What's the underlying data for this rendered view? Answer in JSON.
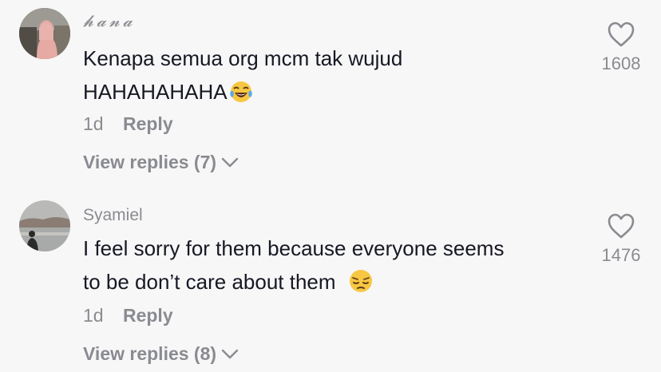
{
  "comments": [
    {
      "username": "𝓱𝓪𝓷𝓪",
      "text_line1": "Kenapa semua org mcm tak wujud",
      "text_line2": "HAHAHAHAHA",
      "emoji": "tears-of-joy-emoji",
      "age": "1d",
      "reply_label": "Reply",
      "view_replies": "View replies (7)",
      "likes": "1608"
    },
    {
      "username": "Syamiel",
      "text_line1": "I feel sorry for them because everyone seems",
      "text_line2": "to be don’t care about them",
      "emoji": "pensive-face-emoji",
      "age": "1d",
      "reply_label": "Reply",
      "view_replies": "View replies (8)",
      "likes": "1476"
    }
  ],
  "icons": {
    "like": "heart-outline-icon",
    "expand": "chevron-down-icon"
  },
  "colors": {
    "background": "#f7f7f7",
    "text": "#161823",
    "secondary": "#8a8b91"
  }
}
